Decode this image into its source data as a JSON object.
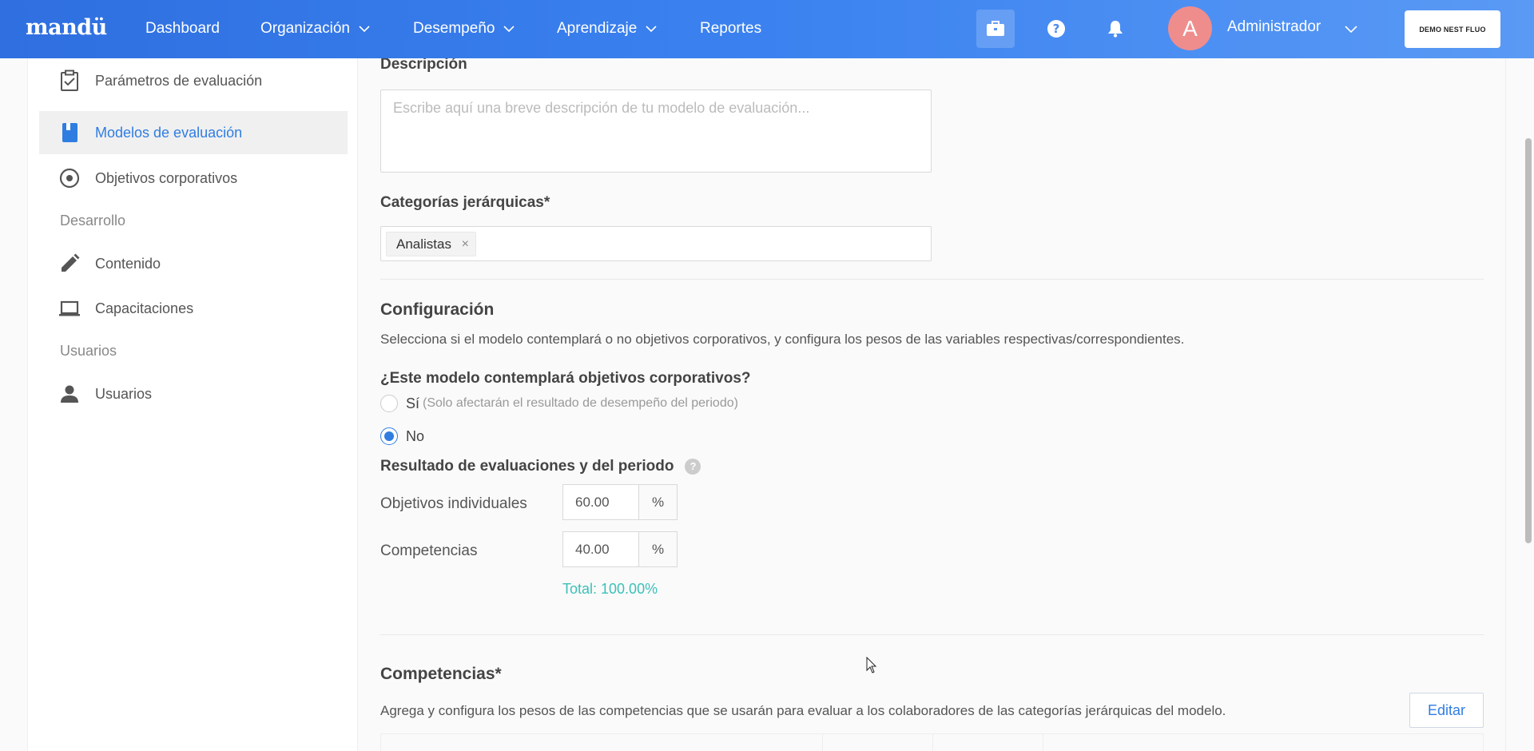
{
  "brand": {
    "logo": "mandü"
  },
  "nav": {
    "items": [
      {
        "label": "Dashboard",
        "has_dropdown": false
      },
      {
        "label": "Organización",
        "has_dropdown": true
      },
      {
        "label": "Desempeño",
        "has_dropdown": true
      },
      {
        "label": "Aprendizaje",
        "has_dropdown": true
      },
      {
        "label": "Reportes",
        "has_dropdown": false
      }
    ],
    "icons": [
      "briefcase-icon",
      "help-icon",
      "bell-icon"
    ],
    "user": {
      "initial": "A",
      "name": "Administrador"
    },
    "demo_button": "DEMO NEST FLUO"
  },
  "sidebar": {
    "items": [
      {
        "label": "Parámetros de evaluación",
        "icon": "clipboard-check-icon",
        "active": false
      },
      {
        "label": "Modelos de evaluación",
        "icon": "book-icon",
        "active": true
      },
      {
        "label": "Objetivos corporativos",
        "icon": "target-icon",
        "active": false
      }
    ],
    "sections": [
      {
        "title": "Desarrollo",
        "items": [
          {
            "label": "Contenido",
            "icon": "pencil-icon"
          },
          {
            "label": "Capacitaciones",
            "icon": "laptop-icon"
          }
        ]
      },
      {
        "title": "Usuarios",
        "items": [
          {
            "label": "Usuarios",
            "icon": "user-icon"
          }
        ]
      }
    ]
  },
  "form": {
    "description": {
      "label": "Descripción",
      "placeholder": "Escribe aquí una breve descripción de tu modelo de evaluación..."
    },
    "categories": {
      "label": "Categorías jerárquicas*",
      "tags": [
        "Analistas"
      ]
    },
    "config": {
      "title": "Configuración",
      "description": "Selecciona si el modelo contemplará o no objetivos corporativos, y configura los pesos de las variables respectivas/correspondientes.",
      "question": "¿Este modelo contemplará objetivos corporativos?",
      "options": [
        {
          "label": "Sí",
          "hint": "(Solo afectarán el resultado de desempeño del periodo)",
          "checked": false
        },
        {
          "label": "No",
          "hint": "",
          "checked": true
        }
      ],
      "results_title": "Resultado de evaluaciones y del periodo",
      "help_glyph": "?",
      "weights": [
        {
          "label": "Objetivos individuales",
          "value": "60.00",
          "unit": "%"
        },
        {
          "label": "Competencias",
          "value": "40.00",
          "unit": "%"
        }
      ],
      "total": "Total: 100.00%"
    },
    "competencias": {
      "title": "Competencias*",
      "description": "Agrega y configura los pesos de las competencias que se usarán para evaluar a los colaboradores de las categorías jerárquicas del modelo.",
      "edit_button": "Editar"
    }
  },
  "colors": {
    "accent": "#2f7de1",
    "total": "#3cc0b8",
    "avatar": "#ef8d8d"
  }
}
